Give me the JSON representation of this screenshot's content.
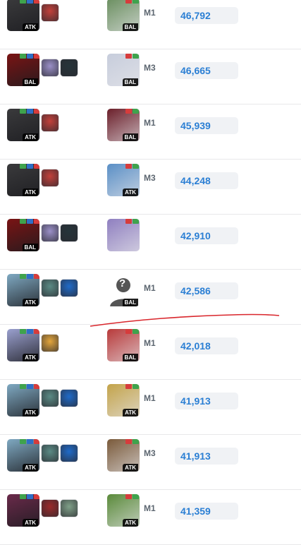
{
  "rows": [
    {
      "team_tag": "ATK",
      "boss_tag": "BAL",
      "mode": "M1",
      "score": "46,792",
      "main_color": "#3a3a3c",
      "subs": [
        "#c2403a"
      ],
      "boss_color": "#6b8f60"
    },
    {
      "team_tag": "BAL",
      "boss_tag": "BAL",
      "mode": "M3",
      "score": "46,665",
      "main_color": "#7a1414",
      "subs": [
        "#9a8fc7",
        "#26343a"
      ],
      "boss_color": "#c7cddc"
    },
    {
      "team_tag": "ATK",
      "boss_tag": "BAL",
      "mode": "M1",
      "score": "45,939",
      "main_color": "#3a3a3c",
      "subs": [
        "#c2403a"
      ],
      "boss_color": "#6b1f2a"
    },
    {
      "team_tag": "ATK",
      "boss_tag": "ATK",
      "mode": "M3",
      "score": "44,248",
      "main_color": "#3a3a3c",
      "subs": [
        "#c2403a"
      ],
      "boss_color": "#5a8fc6"
    },
    {
      "team_tag": "BAL",
      "boss_tag": "",
      "mode": "",
      "score": "42,910",
      "main_color": "#7a1414",
      "subs": [
        "#9a8fc7",
        "#26343a"
      ],
      "boss_color": "#8f7fc0"
    },
    {
      "team_tag": "ATK",
      "boss_tag": "BAL",
      "mode": "M1",
      "score": "42,586",
      "main_color": "#7fa9c2",
      "subs": [
        "#5a8a84",
        "#1f6ac8"
      ],
      "boss_color": "unknown"
    },
    {
      "team_tag": "ATK",
      "boss_tag": "BAL",
      "mode": "M1",
      "score": "42,018",
      "main_color": "#9aa0cf",
      "subs": [
        "#e3a53b"
      ],
      "boss_color": "#b83a3a"
    },
    {
      "team_tag": "ATK",
      "boss_tag": "ATK",
      "mode": "M1",
      "score": "41,913",
      "main_color": "#7fa9c2",
      "subs": [
        "#5a8a84",
        "#1f6ac8"
      ],
      "boss_color": "#c3a34a"
    },
    {
      "team_tag": "ATK",
      "boss_tag": "ATK",
      "mode": "M3",
      "score": "41,913",
      "main_color": "#7fa9c2",
      "subs": [
        "#5a8a84",
        "#1f6ac8"
      ],
      "boss_color": "#7a5a3a"
    },
    {
      "team_tag": "ATK",
      "boss_tag": "ATK",
      "mode": "M1",
      "score": "41,359",
      "main_color": "#6a2a4a",
      "subs": [
        "#9a2a2a",
        "#7fa088"
      ],
      "boss_color": "#5a8a3a"
    }
  ],
  "unknown_glyph": "?",
  "colors": {
    "score_text": "#2b7fd4",
    "score_bg": "#f0f2f5",
    "annotation": "#d9262c"
  },
  "icons": {
    "mini_badges": [
      "green-leaf-icon",
      "blue-shield-icon",
      "red-element-icon"
    ]
  }
}
